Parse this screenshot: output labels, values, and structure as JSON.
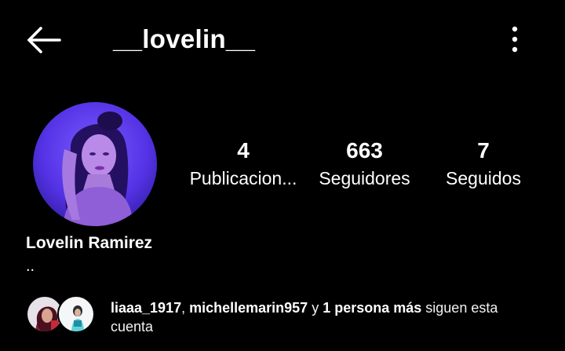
{
  "header": {
    "username": "__lovelin__",
    "back_icon": "arrow-left-icon",
    "more_icon": "more-vertical-icon"
  },
  "profile": {
    "display_name": "Lovelin Ramirez",
    "bio": "..",
    "avatar_colors": {
      "primary": "#5b3cf0",
      "secondary": "#3a1fb0"
    }
  },
  "stats": [
    {
      "value": "4",
      "label": "Publicacion..."
    },
    {
      "value": "663",
      "label": "Seguidores"
    },
    {
      "value": "7",
      "label": "Seguidos"
    }
  ],
  "followed_by": {
    "user1": "liaaa_1917",
    "sep": ", ",
    "user2": "michellemarin957",
    "and": " y ",
    "more": "1 persona más",
    "suffix": " siguen esta cuenta"
  },
  "colors": {
    "background": "#000000",
    "text": "#ffffff"
  }
}
